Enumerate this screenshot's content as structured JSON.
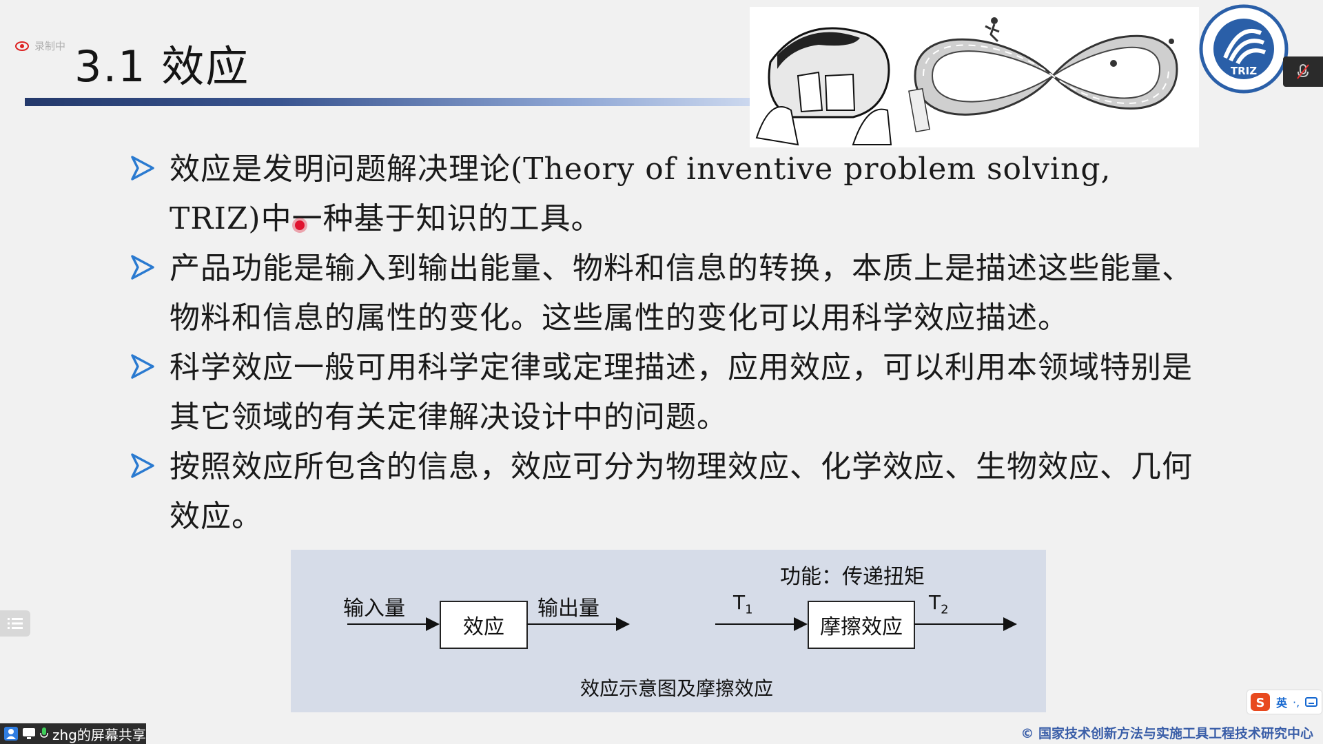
{
  "recording": {
    "label": "录制中"
  },
  "slide": {
    "title": "3.1  效应",
    "bullets": [
      "效应是发明问题解决理论(Theory of inventive problem solving, TRIZ)中一种基于知识的工具。",
      "产品功能是输入到输出能量、物料和信息的转换，本质上是描述这些能量、物料和信息的属性的变化。这些属性的变化可以用科学效应描述。",
      "科学效应一般可用科学定律或定理描述，应用效应，可以利用本领域特别是其它领域的有关定律解决设计中的问题。",
      "按照效应所包含的信息，效应可分为物理效应、化学效应、生物效应、几何效应。"
    ],
    "diagram": {
      "left_input": "输入量",
      "left_box": "效应",
      "left_output": "输出量",
      "right_function": "功能：传递扭矩",
      "right_input": "T",
      "right_input_sub": "1",
      "right_box": "摩擦效应",
      "right_output": "T",
      "right_output_sub": "2",
      "caption": "效应示意图及摩擦效应"
    },
    "logo_text": "TRIZ",
    "footer": "© 国家技术创新方法与实施工具工程技术研究中心"
  },
  "screen_share": {
    "label": "zhg的屏幕共享"
  },
  "ime": {
    "lang": "英",
    "punct": "·,"
  },
  "colors": {
    "accent": "#2a5fa8",
    "bullet_arrow": "#2a7ad0",
    "diagram_bg": "#d6dce8",
    "pointer": "#e0132f"
  },
  "icons": [
    "record-icon",
    "mic-off-icon",
    "menu-list-icon",
    "user-icon",
    "screen-share-icon",
    "mic-icon",
    "sogou-ime-icon",
    "keyboard-icon",
    "triz-logo"
  ]
}
